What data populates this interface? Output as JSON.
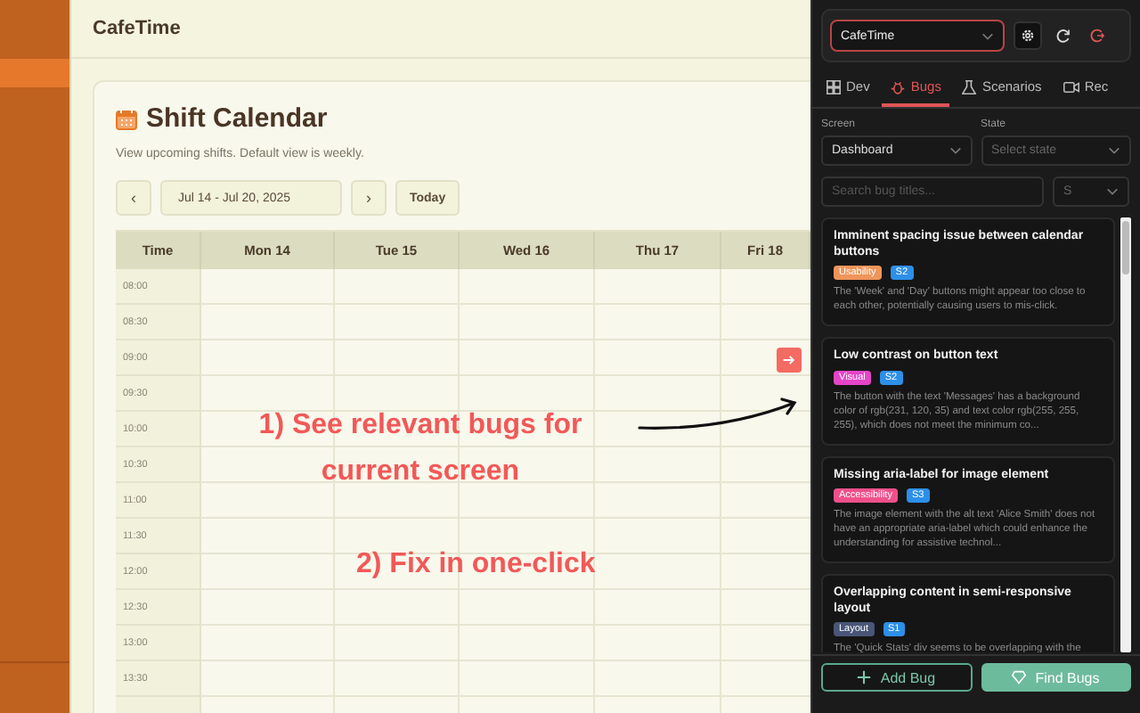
{
  "app": {
    "brand": "CafeTime"
  },
  "calendar": {
    "title": "Shift Calendar",
    "subtitle": "View upcoming shifts. Default view is weekly.",
    "prev": "‹",
    "range": "Jul 14 - Jul 20, 2025",
    "next": "›",
    "today": "Today",
    "columns": [
      "Time",
      "Mon 14",
      "Tue 15",
      "Wed 16",
      "Thu 17",
      "Fri 18"
    ],
    "times": [
      "08:00",
      "08:30",
      "09:00",
      "09:30",
      "10:00",
      "10:30",
      "11:00",
      "11:30",
      "12:00",
      "12:30",
      "13:00",
      "13:30"
    ]
  },
  "annotations": [
    {
      "text": "1) See relevant bugs for current screen"
    },
    {
      "text": "2) Fix in one-click"
    }
  ],
  "panel": {
    "project": "CafeTime",
    "tabs": [
      {
        "label": "Dev",
        "kind": "dev",
        "selected": false
      },
      {
        "label": "Bugs",
        "kind": "bugs",
        "selected": true
      },
      {
        "label": "Scenarios",
        "kind": "scenarios",
        "selected": false
      },
      {
        "label": "Rec",
        "kind": "rec",
        "selected": false
      }
    ],
    "screen": {
      "label": "Screen",
      "value": "Dashboard"
    },
    "state": {
      "label": "State",
      "placeholder": "Select state"
    },
    "search": {
      "placeholder": "Search bug titles..."
    },
    "severity_filter": {
      "placeholder": "S"
    },
    "bugs": [
      {
        "title": "Imminent spacing issue between calendar buttons",
        "tag": "Usability",
        "color": "#f0955a",
        "severity": "S2",
        "description": "The 'Week' and 'Day' buttons might appear too close to each other, potentially causing users to mis-click."
      },
      {
        "title": "Low contrast on button text",
        "tag": "Visual",
        "color": "#e545c8",
        "severity": "S2",
        "description": "The button with the text 'Messages' has a background color of rgb(231, 120, 35) and text color rgb(255, 255, 255), which does not meet the minimum co..."
      },
      {
        "title": "Missing aria-label for image element",
        "tag": "Accessibility",
        "color": "#f0508a",
        "severity": "S3",
        "description": "The image element with the alt text 'Alice Smith' does not have an appropriate aria-label which could enhance the understanding for assistive technol..."
      },
      {
        "title": "Overlapping content in semi-responsive layout",
        "tag": "Layout",
        "color": "#4a5678",
        "severity": "S1",
        "description": "The 'Quick Stats' div seems to be overlapping with the"
      }
    ],
    "add_button": "Add Bug",
    "find_button": "Find Bugs"
  }
}
